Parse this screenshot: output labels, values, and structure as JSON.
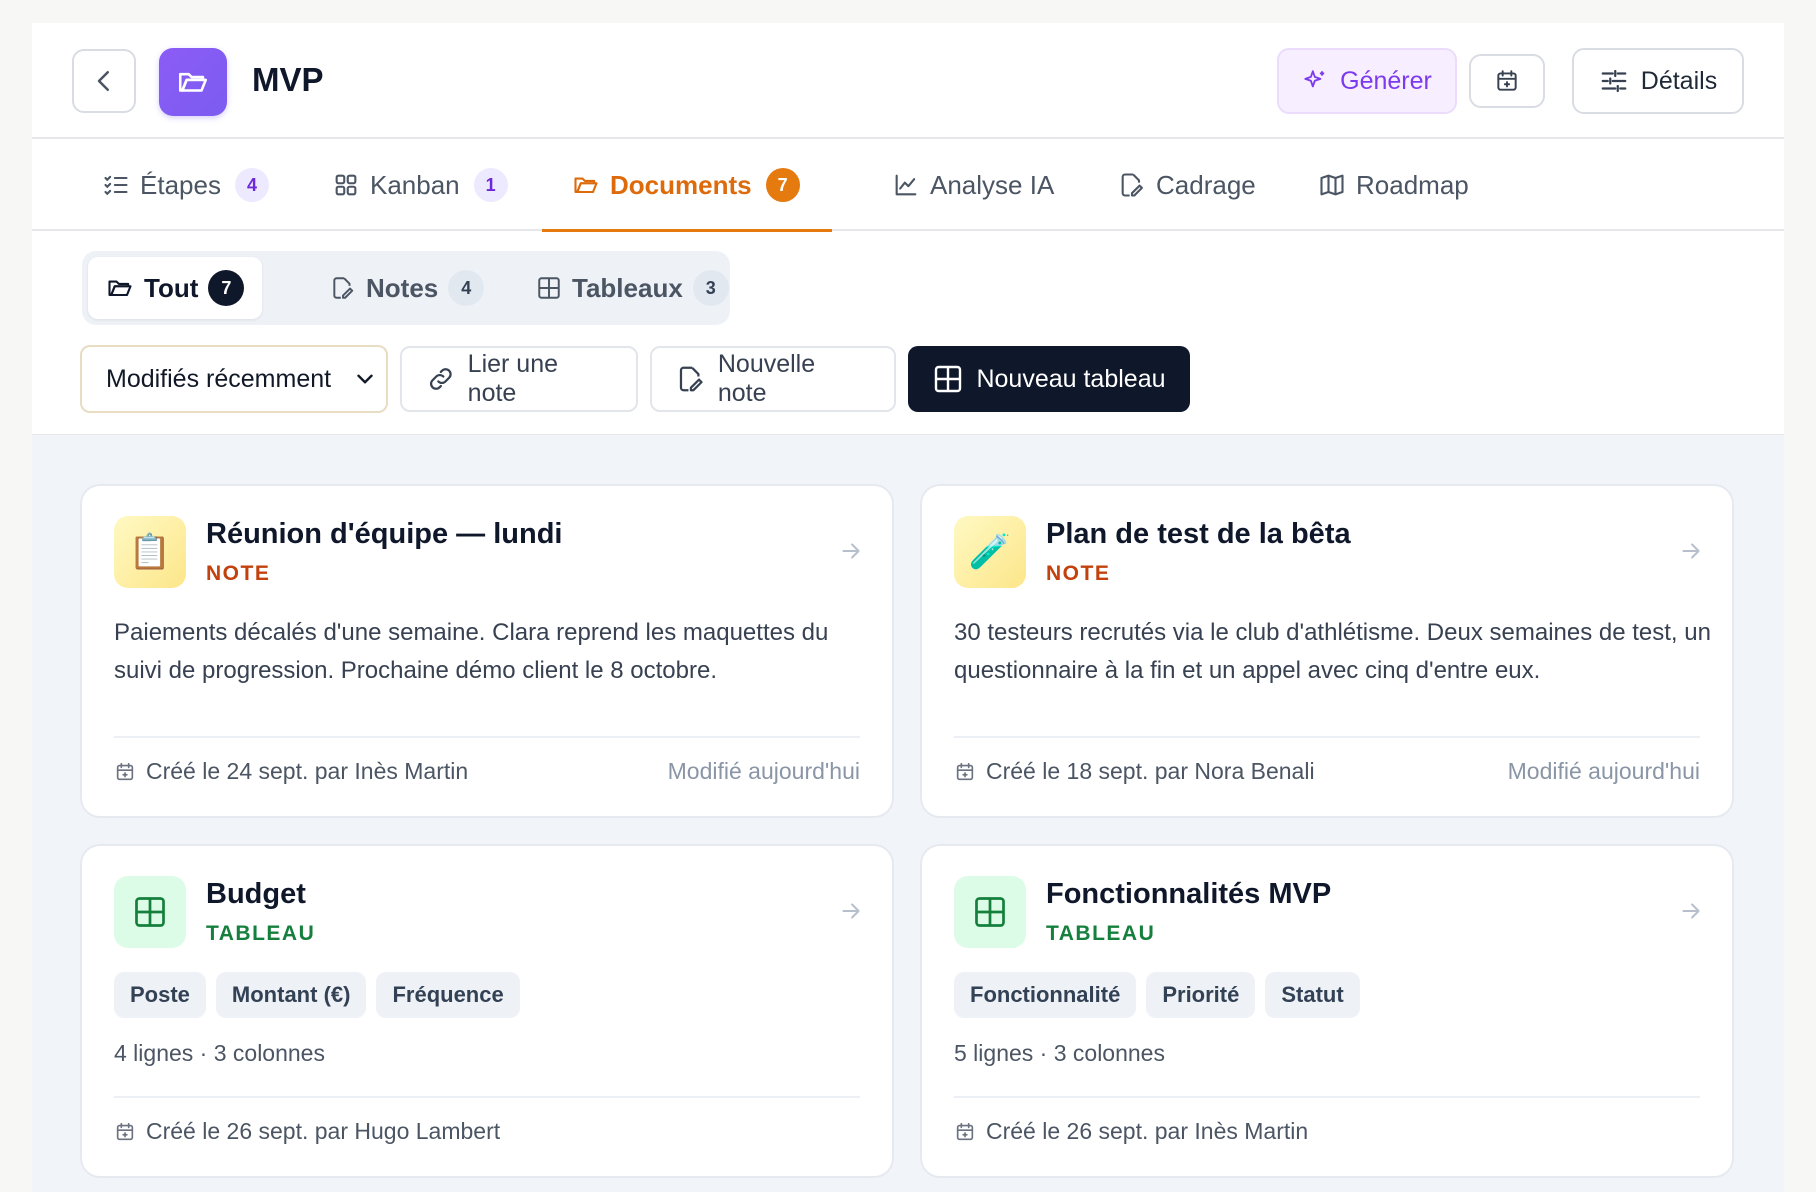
{
  "header": {
    "title": "MVP",
    "generate_label": "Générer",
    "details_label": "Détails"
  },
  "tabs": [
    {
      "label": "Étapes",
      "count": "4",
      "icon": "list-checks-icon"
    },
    {
      "label": "Kanban",
      "count": "1",
      "icon": "grid-icon"
    },
    {
      "label": "Documents",
      "count": "7",
      "icon": "folder-open-icon",
      "active": true
    },
    {
      "label": "Analyse IA",
      "icon": "line-chart-icon"
    },
    {
      "label": "Cadrage",
      "icon": "file-pen-icon"
    },
    {
      "label": "Roadmap",
      "icon": "map-icon"
    }
  ],
  "filters": [
    {
      "label": "Tout",
      "count": "7",
      "active": true
    },
    {
      "label": "Notes",
      "count": "4"
    },
    {
      "label": "Tableaux",
      "count": "3"
    }
  ],
  "toolbar": {
    "sort_value": "Modifiés récemment",
    "link_note_label": "Lier une note",
    "new_note_label": "Nouvelle note",
    "new_table_label": "Nouveau tableau"
  },
  "cards": [
    {
      "title": "Réunion d'équipe — lundi",
      "kind": "NOTE",
      "emoji": "📋",
      "desc": "Paiements décalés d'une semaine. Clara reprend les maquettes du suivi de progression. Prochaine démo client le 8 octobre.",
      "created": "Créé le 24 sept. par Inès Martin",
      "modified": "Modifié aujourd'hui"
    },
    {
      "title": "Plan de test de la bêta",
      "kind": "NOTE",
      "emoji": "🧪",
      "desc": "30 testeurs recrutés via le club d'athlétisme. Deux semaines de test, un questionnaire à la fin et un appel avec cinq d'entre eux.",
      "created": "Créé le 18 sept. par Nora Benali",
      "modified": "Modifié aujourd'hui"
    },
    {
      "title": "Budget",
      "kind": "TABLEAU",
      "columns": [
        "Poste",
        "Montant (€)",
        "Fréquence"
      ],
      "meta": "4 lignes · 3 colonnes",
      "created": "Créé le 26 sept. par Hugo Lambert"
    },
    {
      "title": "Fonctionnalités MVP",
      "kind": "TABLEAU",
      "columns": [
        "Fonctionnalité",
        "Priorité",
        "Statut"
      ],
      "meta": "5 lignes · 3 colonnes",
      "created": "Créé le 26 sept. par Inès Martin"
    }
  ],
  "colors": {
    "accent": "#e57a0f",
    "brand_purple": "#7c5cf0",
    "primary_dark": "#0f172a"
  }
}
